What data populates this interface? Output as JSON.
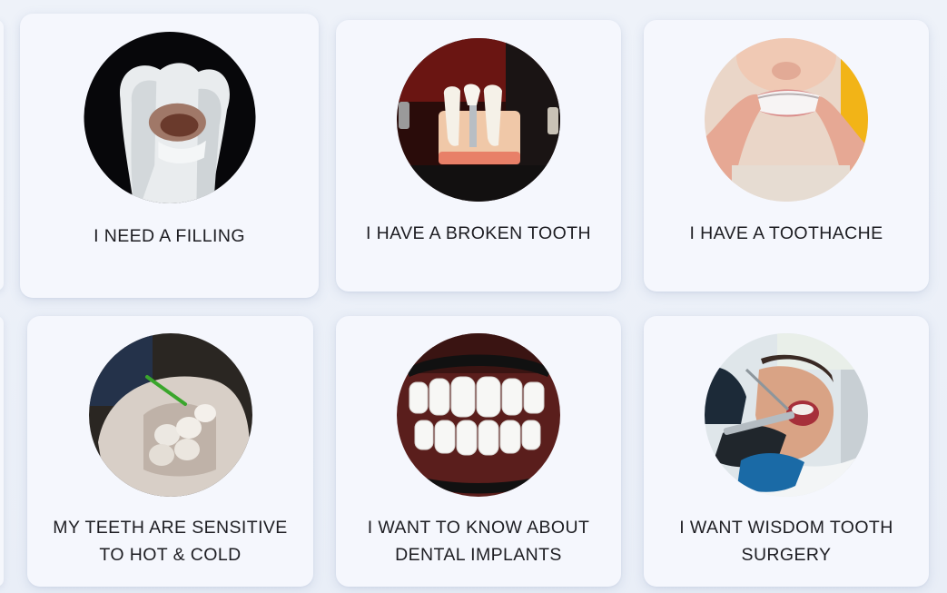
{
  "cards": [
    {
      "label_lines": [
        "I NEED A FILLING"
      ],
      "image": "decayed-tooth-photo"
    },
    {
      "label_lines": [
        "I HAVE A BROKEN TOOTH"
      ],
      "image": "dental-implant-model-photo"
    },
    {
      "label_lines": [
        "I HAVE A TOOTHACHE"
      ],
      "image": "clear-aligner-photo"
    },
    {
      "label_lines": [
        "MY TEETH ARE SENSITIVE",
        "TO HOT & COLD"
      ],
      "image": "sensitive-teeth-model-photo"
    },
    {
      "label_lines": [
        "I WANT TO KNOW ABOUT",
        "DENTAL IMPLANTS"
      ],
      "image": "white-teeth-closeup-photo"
    },
    {
      "label_lines": [
        "I WANT WISDOM TOOTH",
        "SURGERY"
      ],
      "image": "dental-surgery-photo"
    }
  ]
}
